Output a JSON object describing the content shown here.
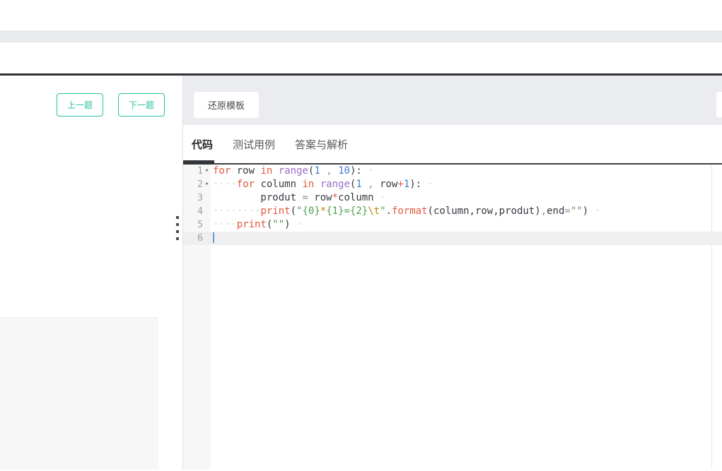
{
  "left_nav": {
    "prev_label": "上一题",
    "next_label": "下一题"
  },
  "toolbar": {
    "restore_label": "还原模板"
  },
  "tabs": {
    "items": [
      {
        "name": "tab-code",
        "label": "代码",
        "active": true
      },
      {
        "name": "tab-test-cases",
        "label": "测试用例",
        "active": false
      },
      {
        "name": "tab-answer-analysis",
        "label": "答案与解析",
        "active": false
      }
    ]
  },
  "editor": {
    "language": "python",
    "lines": [
      {
        "num": "1",
        "fold": true,
        "active": false,
        "cursor": false,
        "tokens": [
          [
            "kw",
            "for"
          ],
          [
            "t",
            " row "
          ],
          [
            "kw",
            "in"
          ],
          [
            "t",
            " "
          ],
          [
            "bi",
            "range"
          ],
          [
            "t",
            "("
          ],
          [
            "num",
            "1"
          ],
          [
            "pu",
            " , "
          ],
          [
            "num",
            "10"
          ],
          [
            "t",
            "):"
          ],
          [
            "ws",
            " ·"
          ]
        ]
      },
      {
        "num": "2",
        "fold": true,
        "active": false,
        "cursor": false,
        "tokens": [
          [
            "ws",
            "····"
          ],
          [
            "kw",
            "for"
          ],
          [
            "t",
            " column "
          ],
          [
            "kw",
            "in"
          ],
          [
            "t",
            " "
          ],
          [
            "bi",
            "range"
          ],
          [
            "t",
            "("
          ],
          [
            "num",
            "1"
          ],
          [
            "pu",
            " , "
          ],
          [
            "t",
            "row"
          ],
          [
            "op",
            "+"
          ],
          [
            "num",
            "1"
          ],
          [
            "t",
            "):"
          ],
          [
            "ws",
            " ·"
          ]
        ]
      },
      {
        "num": "3",
        "fold": false,
        "active": false,
        "cursor": false,
        "tokens": [
          [
            "t",
            "        produt "
          ],
          [
            "pu",
            "="
          ],
          [
            "t",
            " row"
          ],
          [
            "op",
            "*"
          ],
          [
            "t",
            "column"
          ],
          [
            "ws",
            " ·"
          ]
        ]
      },
      {
        "num": "4",
        "fold": false,
        "active": false,
        "cursor": false,
        "tokens": [
          [
            "ws",
            "········"
          ],
          [
            "kw",
            "print"
          ],
          [
            "t",
            "("
          ],
          [
            "str",
            "\"{0}"
          ],
          [
            "esc",
            "*"
          ],
          [
            "str",
            "{1}={2}"
          ],
          [
            "esc",
            "\\t"
          ],
          [
            "str",
            "\""
          ],
          [
            "t",
            "."
          ],
          [
            "kw",
            "format"
          ],
          [
            "t",
            "(column,row,produt)"
          ],
          [
            "pu",
            ","
          ],
          [
            "t",
            "end"
          ],
          [
            "pu",
            "="
          ],
          [
            "str",
            "\"\""
          ],
          [
            "t",
            ")"
          ],
          [
            "ws",
            " ·"
          ]
        ]
      },
      {
        "num": "5",
        "fold": false,
        "active": false,
        "cursor": false,
        "tokens": [
          [
            "ws",
            "····"
          ],
          [
            "kw",
            "print"
          ],
          [
            "t",
            "("
          ],
          [
            "str",
            "\"\""
          ],
          [
            "t",
            ")"
          ],
          [
            "ws",
            " ·"
          ]
        ]
      },
      {
        "num": "6",
        "fold": false,
        "active": true,
        "cursor": true,
        "tokens": []
      }
    ]
  },
  "colors": {
    "teal": "#2bc0a3",
    "kw": "#e2583e",
    "bi": "#9b6bc9",
    "num": "#3e7fd1",
    "str": "#50a14f",
    "esc": "#c18401",
    "op": "#e2583e",
    "pu": "#8f9398",
    "ws": "#d4d7d9",
    "cursor": "#6a9bd8",
    "dark_divider": "#2f3134",
    "toolbar_bg": "#eaecef"
  }
}
